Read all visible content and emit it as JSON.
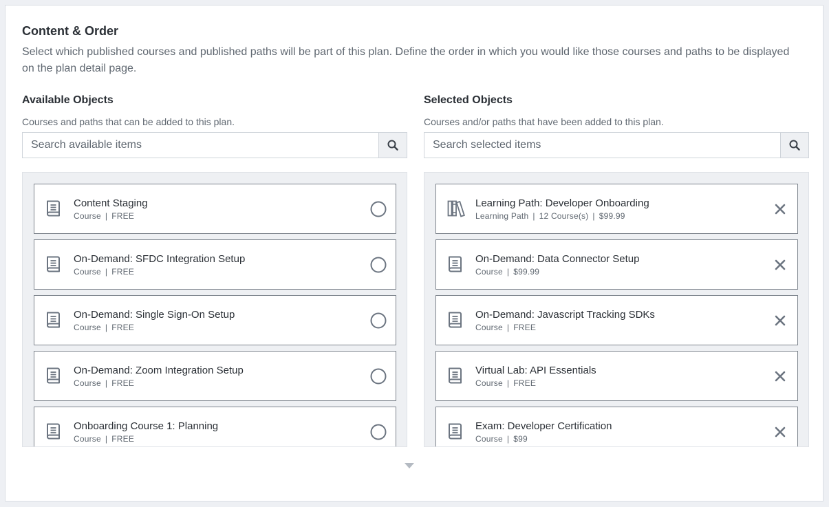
{
  "section": {
    "title": "Content & Order",
    "description": "Select which published courses and published paths will be part of this plan. Define the order in which you would like those courses and paths to be displayed on the plan detail page."
  },
  "available": {
    "title": "Available Objects",
    "subtitle": "Courses and paths that can be added to this plan.",
    "search_placeholder": "Search available items",
    "items": [
      {
        "name": "Content Staging",
        "type": "Course",
        "price": "FREE",
        "icon": "book-icon",
        "action_icon": "circle-select-icon"
      },
      {
        "name": "On-Demand: SFDC Integration Setup",
        "type": "Course",
        "price": "FREE",
        "icon": "book-icon",
        "action_icon": "circle-select-icon"
      },
      {
        "name": "On-Demand: Single Sign-On Setup",
        "type": "Course",
        "price": "FREE",
        "icon": "book-icon",
        "action_icon": "circle-select-icon"
      },
      {
        "name": "On-Demand: Zoom Integration Setup",
        "type": "Course",
        "price": "FREE",
        "icon": "book-icon",
        "action_icon": "circle-select-icon"
      },
      {
        "name": "Onboarding Course 1: Planning",
        "type": "Course",
        "price": "FREE",
        "icon": "book-icon",
        "action_icon": "circle-select-icon"
      }
    ]
  },
  "selected": {
    "title": "Selected Objects",
    "subtitle": "Courses and/or paths that have been added to this plan.",
    "search_placeholder": "Search selected items",
    "items": [
      {
        "name": "Learning Path: Developer Onboarding",
        "type": "Learning Path",
        "extra": "12 Course(s)",
        "price": "$99.99",
        "icon": "books-icon",
        "action_icon": "remove-x-icon"
      },
      {
        "name": "On-Demand: Data Connector Setup",
        "type": "Course",
        "price": "$99.99",
        "icon": "book-icon",
        "action_icon": "remove-x-icon"
      },
      {
        "name": "On-Demand: Javascript Tracking SDKs",
        "type": "Course",
        "price": "FREE",
        "icon": "book-icon",
        "action_icon": "remove-x-icon"
      },
      {
        "name": "Virtual Lab: API Essentials",
        "type": "Course",
        "price": "FREE",
        "icon": "book-icon",
        "action_icon": "remove-x-icon"
      },
      {
        "name": "Exam: Developer Certification",
        "type": "Course",
        "price": "$99",
        "icon": "book-icon",
        "action_icon": "remove-x-icon"
      }
    ]
  },
  "colors": {
    "panel_bg": "#eef0f3",
    "border": "#7b828b",
    "icon": "#6b7480",
    "text_primary": "#2a2f35",
    "text_secondary": "#5f6770"
  }
}
